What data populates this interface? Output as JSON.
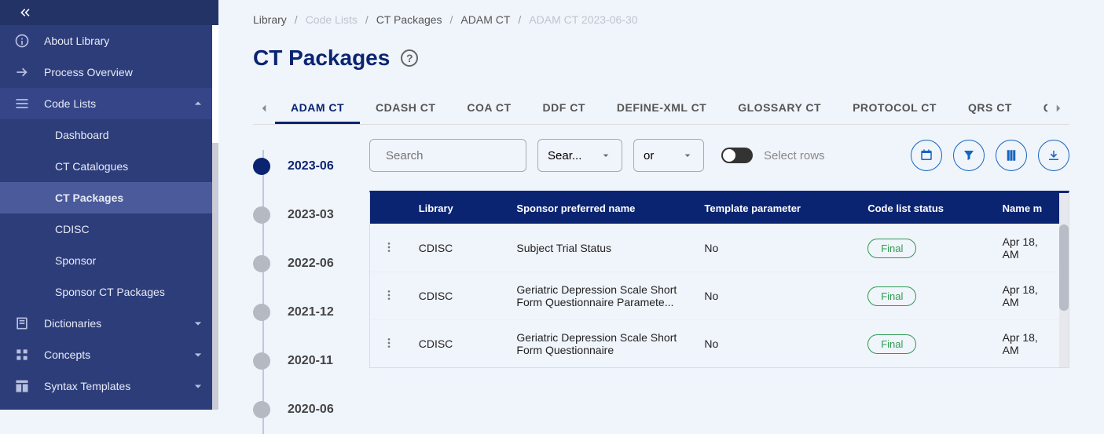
{
  "sidebar": {
    "items": [
      {
        "label": "About Library"
      },
      {
        "label": "Process Overview"
      },
      {
        "label": "Code Lists"
      },
      {
        "label": "Dashboard"
      },
      {
        "label": "CT Catalogues"
      },
      {
        "label": "CT Packages"
      },
      {
        "label": "CDISC"
      },
      {
        "label": "Sponsor"
      },
      {
        "label": "Sponsor CT Packages"
      },
      {
        "label": "Dictionaries"
      },
      {
        "label": "Concepts"
      },
      {
        "label": "Syntax Templates"
      }
    ]
  },
  "breadcrumb": [
    "Library",
    "Code Lists",
    "CT Packages",
    "ADAM CT",
    "ADAM CT 2023-06-30"
  ],
  "page_title": "CT Packages",
  "tabs": [
    "ADAM CT",
    "CDASH CT",
    "COA CT",
    "DDF CT",
    "DEFINE-XML CT",
    "GLOSSARY CT",
    "PROTOCOL CT",
    "QRS CT",
    "Q"
  ],
  "timeline": [
    "2023-06",
    "2023-03",
    "2022-06",
    "2021-12",
    "2020-11",
    "2020-06"
  ],
  "toolbar": {
    "search_placeholder": "Search",
    "select1": "Sear...",
    "select2": "or",
    "toggle_label": "Select rows"
  },
  "table": {
    "headers": [
      "Library",
      "Sponsor preferred name",
      "Template parameter",
      "Code list status",
      "Name m"
    ],
    "rows": [
      {
        "library": "CDISC",
        "name": "Subject Trial Status",
        "tp": "No",
        "status": "Final",
        "date": "Apr 18, AM"
      },
      {
        "library": "CDISC",
        "name": "Geriatric Depression Scale Short Form Questionnaire Paramete...",
        "tp": "No",
        "status": "Final",
        "date": "Apr 18, AM"
      },
      {
        "library": "CDISC",
        "name": "Geriatric Depression Scale Short Form Questionnaire",
        "tp": "No",
        "status": "Final",
        "date": "Apr 18, AM"
      }
    ]
  }
}
